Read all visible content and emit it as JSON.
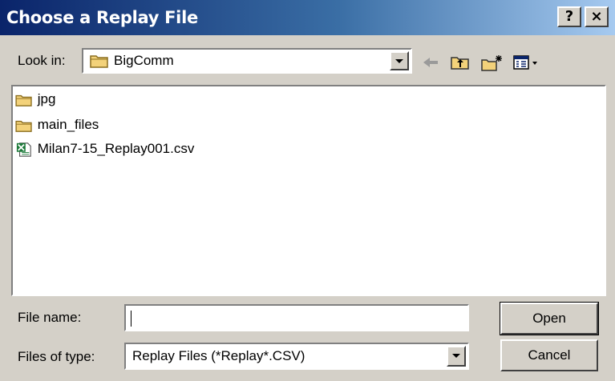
{
  "window": {
    "title": "Choose a Replay File",
    "help_button": "?",
    "close_button": "×"
  },
  "look_in": {
    "label": "Look in:",
    "value": "BigComm"
  },
  "toolbar": {
    "icons": [
      "back-arrow-icon",
      "up-folder-icon",
      "new-folder-icon",
      "view-menu-icon"
    ]
  },
  "files": [
    {
      "name": "jpg",
      "icon": "folder-icon"
    },
    {
      "name": "main_files",
      "icon": "folder-icon"
    },
    {
      "name": "Milan7-15_Replay001.csv",
      "icon": "excel-csv-icon"
    }
  ],
  "file_name": {
    "label": "File name:",
    "value": ""
  },
  "files_of_type": {
    "label": "Files of type:",
    "value": "Replay Files (*Replay*.CSV)"
  },
  "buttons": {
    "open": "Open",
    "cancel": "Cancel"
  },
  "colors": {
    "titlebar_start": "#0a246a",
    "titlebar_end": "#a6caf0",
    "face": "#d4d0c8",
    "folder": "#f3d27a"
  }
}
